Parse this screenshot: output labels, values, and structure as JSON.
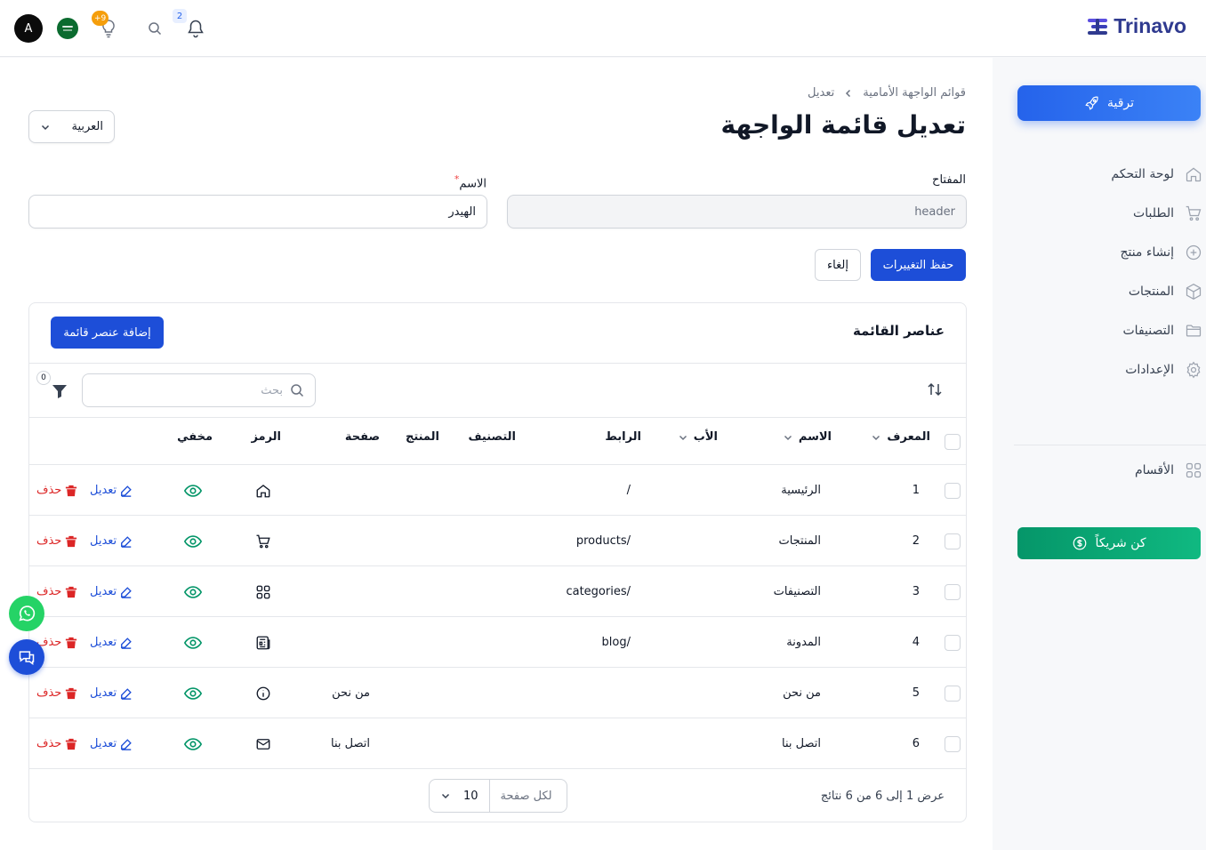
{
  "app": {
    "name": "Trinavo"
  },
  "topbar": {
    "avatar_letter": "A",
    "notifications_count": "2",
    "ideas_count": "+9"
  },
  "sidebar": {
    "upgrade_label": "ترقية",
    "items": [
      {
        "label": "لوحة التحكم",
        "icon": "home-icon"
      },
      {
        "label": "الطلبات",
        "icon": "cart-icon"
      },
      {
        "label": "إنشاء منتج",
        "icon": "plus-circle-icon"
      },
      {
        "label": "المنتجات",
        "icon": "box-icon"
      },
      {
        "label": "التصنيفات",
        "icon": "folder-icon"
      },
      {
        "label": "الإعدادات",
        "icon": "gear-icon"
      }
    ],
    "sections_label": "الأقسام",
    "partner_label": "كن شريكاً"
  },
  "breadcrumb": {
    "parent": "قوائم الواجهة الأمامية",
    "current": "تعديل"
  },
  "page_title": "تعديل قائمة الواجهة",
  "language_select": {
    "value": "العربية"
  },
  "form": {
    "key_label": "المفتاح",
    "key_value": "header",
    "name_label": "الاسم",
    "name_required": "*",
    "name_value": "الهيدر",
    "save_label": "حفظ التغييرات",
    "cancel_label": "إلغاء"
  },
  "items_card": {
    "title": "عناصر القائمة",
    "add_label": "إضافة عنصر قائمة",
    "search_placeholder": "بحث",
    "filter_count": "0",
    "columns": {
      "id": "المعرف",
      "name": "الاسم",
      "parent": "الأب",
      "link": "الرابط",
      "category": "التصنيف",
      "product": "المنتج",
      "page": "صفحة",
      "icon": "الرمز",
      "hidden": "مخفي"
    },
    "rows": [
      {
        "id": "1",
        "name": "الرئيسية",
        "link": "/",
        "page": "",
        "icon": "home-icon"
      },
      {
        "id": "2",
        "name": "المنتجات",
        "link": "/products",
        "page": "",
        "icon": "cart-icon"
      },
      {
        "id": "3",
        "name": "التصنيفات",
        "link": "/categories",
        "page": "",
        "icon": "grid-icon"
      },
      {
        "id": "4",
        "name": "المدونة",
        "link": "/blog",
        "page": "",
        "icon": "newspaper-icon"
      },
      {
        "id": "5",
        "name": "من نحن",
        "link": "",
        "page": "من نحن",
        "icon": "info-icon"
      },
      {
        "id": "6",
        "name": "اتصل بنا",
        "link": "",
        "page": "اتصل بنا",
        "icon": "mail-icon"
      }
    ],
    "edit_label": "تعديل",
    "delete_label": "حذف",
    "footer_info": "عرض 1 إلى 6 من 6 نتائج",
    "per_page_label": "لكل صفحة",
    "per_page_value": "10"
  },
  "colors": {
    "primary": "#1d4ed8",
    "danger": "#dc2626",
    "success": "#059669",
    "whatsapp": "#25d366"
  }
}
